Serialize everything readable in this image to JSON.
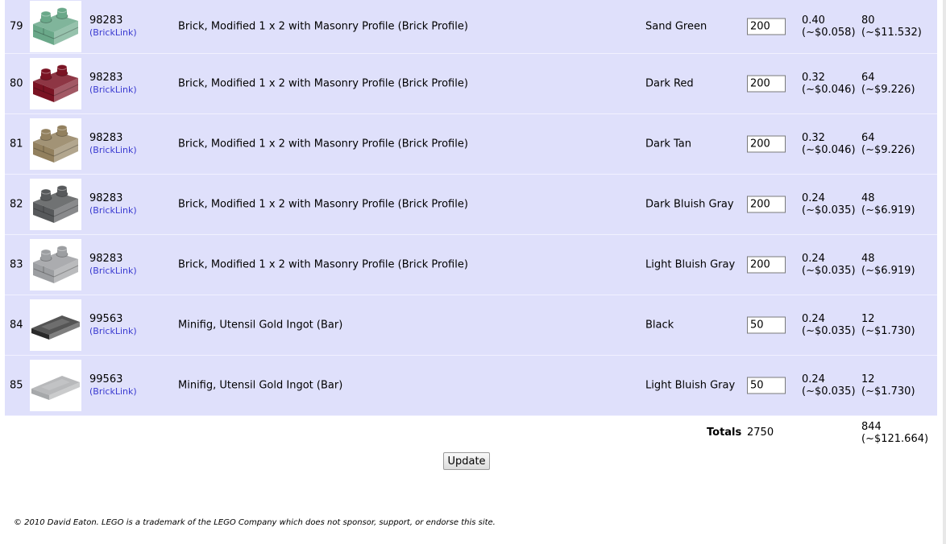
{
  "rows": [
    {
      "num": "79",
      "part_id": "98283",
      "link": "(BrickLink)",
      "desc": "Brick, Modified 1 x 2 with Masonry Profile (Brick Profile)",
      "color": "Sand Green",
      "qty": "200",
      "unit_a": "0.40",
      "unit_b": "(~$0.058)",
      "total_a": "80",
      "total_b": "(~$11.532)",
      "icon": "masonry-brick-icon",
      "swatch": "#6aa889"
    },
    {
      "num": "80",
      "part_id": "98283",
      "link": "(BrickLink)",
      "desc": "Brick, Modified 1 x 2 with Masonry Profile (Brick Profile)",
      "color": "Dark Red",
      "qty": "200",
      "unit_a": "0.32",
      "unit_b": "(~$0.046)",
      "total_a": "64",
      "total_b": "(~$9.226)",
      "icon": "masonry-brick-icon",
      "swatch": "#7a1323"
    },
    {
      "num": "81",
      "part_id": "98283",
      "link": "(BrickLink)",
      "desc": "Brick, Modified 1 x 2 with Masonry Profile (Brick Profile)",
      "color": "Dark Tan",
      "qty": "200",
      "unit_a": "0.32",
      "unit_b": "(~$0.046)",
      "total_a": "64",
      "total_b": "(~$9.226)",
      "icon": "masonry-brick-icon",
      "swatch": "#92805e"
    },
    {
      "num": "82",
      "part_id": "98283",
      "link": "(BrickLink)",
      "desc": "Brick, Modified 1 x 2 with Masonry Profile (Brick Profile)",
      "color": "Dark Bluish Gray",
      "qty": "200",
      "unit_a": "0.24",
      "unit_b": "(~$0.035)",
      "total_a": "48",
      "total_b": "(~$6.919)",
      "icon": "masonry-brick-icon",
      "swatch": "#57595b"
    },
    {
      "num": "83",
      "part_id": "98283",
      "link": "(BrickLink)",
      "desc": "Brick, Modified 1 x 2 with Masonry Profile (Brick Profile)",
      "color": "Light Bluish Gray",
      "qty": "200",
      "unit_a": "0.24",
      "unit_b": "(~$0.035)",
      "total_a": "48",
      "total_b": "(~$6.919)",
      "icon": "masonry-brick-icon",
      "swatch": "#9c9ea1"
    },
    {
      "num": "84",
      "part_id": "99563",
      "link": "(BrickLink)",
      "desc": "Minifig, Utensil Gold Ingot (Bar)",
      "color": "Black",
      "qty": "50",
      "unit_a": "0.24",
      "unit_b": "(~$0.035)",
      "total_a": "12",
      "total_b": "(~$1.730)",
      "icon": "ingot-bar-icon",
      "swatch": "#2a2a2a"
    },
    {
      "num": "85",
      "part_id": "99563",
      "link": "(BrickLink)",
      "desc": "Minifig, Utensil Gold Ingot (Bar)",
      "color": "Light Bluish Gray",
      "qty": "50",
      "unit_a": "0.24",
      "unit_b": "(~$0.035)",
      "total_a": "12",
      "total_b": "(~$1.730)",
      "icon": "ingot-bar-icon",
      "swatch": "#a6a8aa"
    }
  ],
  "totals": {
    "label": "Totals",
    "qty": "2750",
    "price_a": "844",
    "price_b": "(~$121.664)"
  },
  "update_label": "Update",
  "footer": "© 2010 David Eaton. LEGO is a trademark of the LEGO Company which does not sponsor, support, or endorse this site.",
  "colors": {
    "row_bg": "#dfe0fb",
    "link": "#3a3ad0"
  }
}
